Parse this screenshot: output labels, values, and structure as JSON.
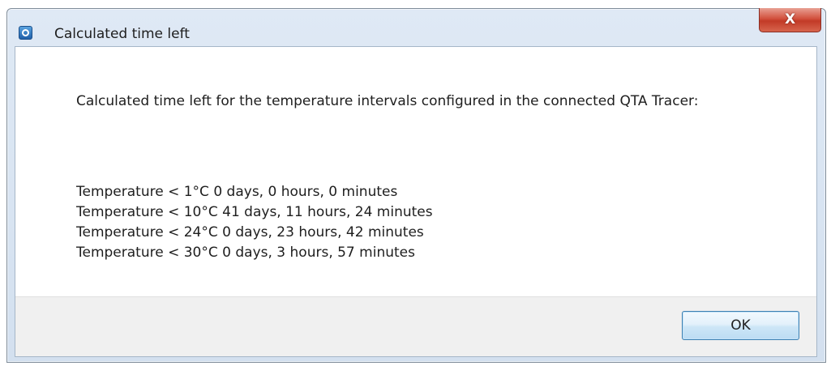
{
  "window": {
    "title": "Calculated time left",
    "app_icon": "app-logo-icon",
    "close_icon": "close-icon",
    "close_label": "X"
  },
  "message": {
    "intro": "Calculated time left for the temperature intervals configured in the connected QTA Tracer:",
    "intervals": [
      {
        "text": "Temperature < 1°C 0 days, 0 hours, 0 minutes"
      },
      {
        "text": "Temperature < 10°C 41 days, 11 hours, 24 minutes"
      },
      {
        "text": "Temperature < 24°C 0 days, 23 hours, 42 minutes"
      },
      {
        "text": "Temperature < 30°C 0 days, 3 hours, 57 minutes"
      }
    ]
  },
  "footer": {
    "ok_label": "OK"
  },
  "colors": {
    "close_button": "#c94a36",
    "ok_button_border": "#3c7fb1",
    "footer_background": "#f0f0f0"
  }
}
